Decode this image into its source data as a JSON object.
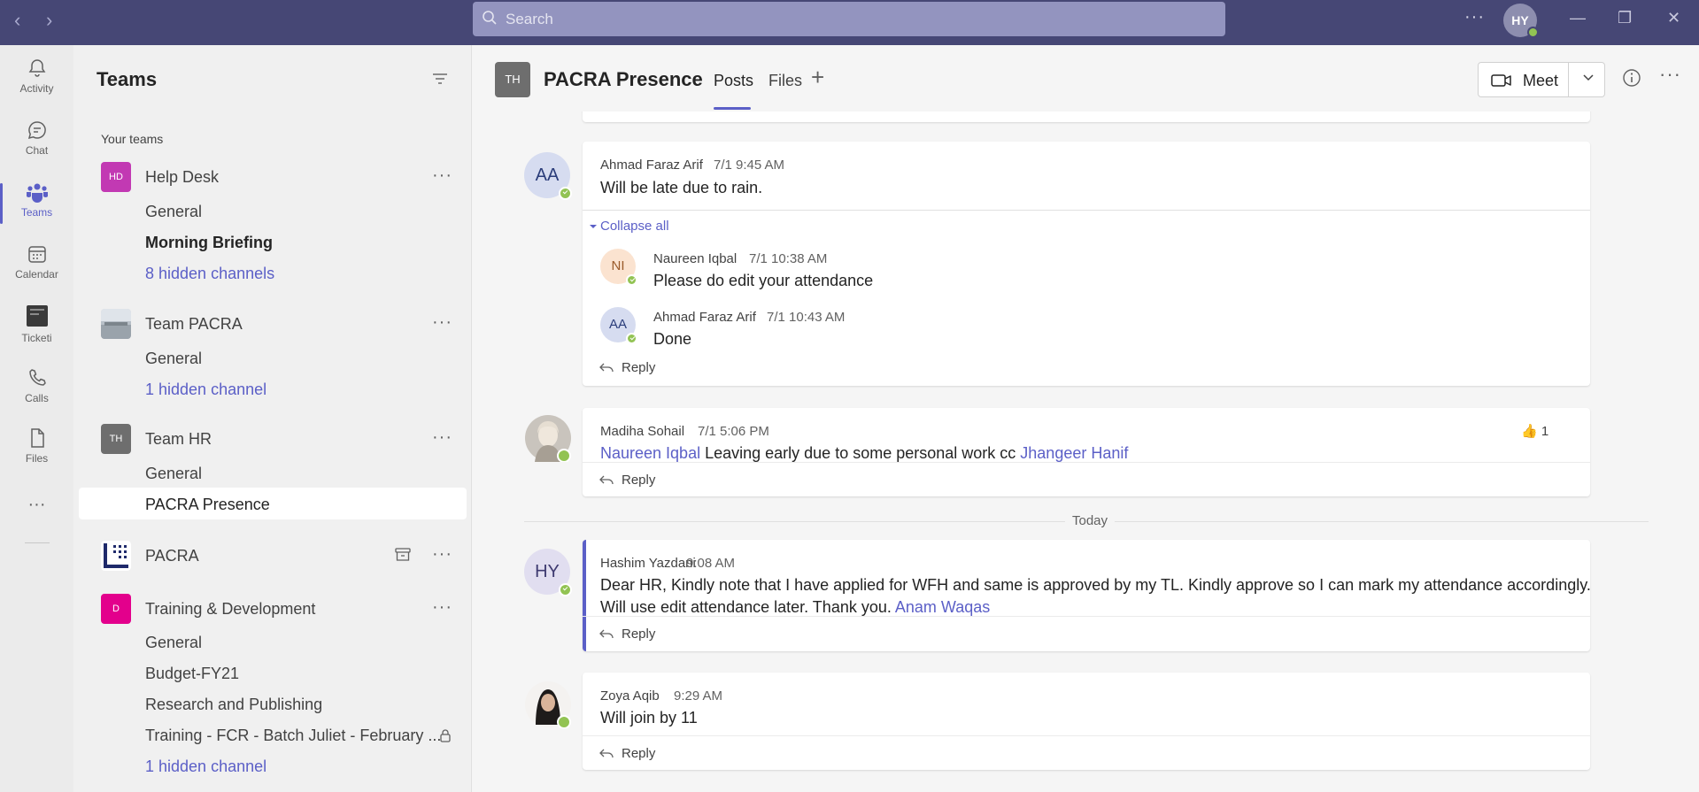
{
  "search": {
    "placeholder": "Search"
  },
  "user": {
    "initials": "HY"
  },
  "appbar": {
    "items": [
      {
        "label": "Activity",
        "icon": "bell-icon"
      },
      {
        "label": "Chat",
        "icon": "chat-icon"
      },
      {
        "label": "Teams",
        "icon": "teams-icon"
      },
      {
        "label": "Calendar",
        "icon": "calendar-icon"
      },
      {
        "label": "Ticketi",
        "icon": "ticketing-app-icon"
      },
      {
        "label": "Calls",
        "icon": "phone-icon"
      },
      {
        "label": "Files",
        "icon": "file-icon"
      }
    ],
    "more": "···"
  },
  "teams": {
    "title": "Teams",
    "section": "Your teams",
    "list": [
      {
        "avatar": "HD",
        "name": "Help Desk",
        "color": "#c239b3",
        "channels": [
          "General",
          "Morning Briefing"
        ],
        "hidden": "8 hidden channels"
      },
      {
        "avatar": "",
        "name": "Team PACRA",
        "channels": [
          "General"
        ],
        "hidden": "1 hidden channel"
      },
      {
        "avatar": "TH",
        "name": "Team HR",
        "color": "#6e6e6e",
        "channels": [
          "General",
          "PACRA Presence"
        ]
      },
      {
        "avatar": "",
        "name": "PACRA"
      },
      {
        "avatar": "D",
        "name": "Training & Development",
        "color": "#e3008c",
        "channels": [
          "General",
          "Budget-FY21",
          "Research and Publishing",
          "Training - FCR - Batch Juliet - February ..."
        ],
        "hidden": "1 hidden channel"
      }
    ]
  },
  "channel": {
    "avatar": "TH",
    "title": "PACRA Presence",
    "tabs": [
      "Posts",
      "Files"
    ],
    "meet": "Meet"
  },
  "feed": {
    "collapse_all": "Collapse all",
    "reply": "Reply",
    "today": "Today",
    "posts": [
      {
        "initials": "AA",
        "author": "Ahmad Faraz Arif",
        "time": "7/1 9:45 AM",
        "text": "Will be late due to rain.",
        "replies": [
          {
            "initials": "NI",
            "author": "Naureen Iqbal",
            "time": "7/1 10:38 AM",
            "text": "Please do edit your attendance"
          },
          {
            "initials": "AA",
            "author": "Ahmad Faraz Arif",
            "time": "7/1 10:43 AM",
            "text": "Done"
          }
        ]
      },
      {
        "author": "Madiha Sohail",
        "time": "7/1 5:06 PM",
        "mention1": "Naureen Iqbal",
        "text": " Leaving early due to some personal work cc ",
        "mention2": "Jhangeer Hanif",
        "reaction_count": "1"
      },
      {
        "initials": "HY",
        "author": "Hashim Yazdani",
        "time": "9:08 AM",
        "line1": "Dear HR, Kindly note that I have applied for WFH and same is approved by my TL. Kindly approve so I can mark my attendance accordingly.",
        "line2": "Will use edit attendance later. Thank you. ",
        "mention": "Anam Waqas"
      },
      {
        "author": "Zoya Aqib",
        "time": "9:29 AM",
        "text": "Will join by 11"
      }
    ]
  }
}
